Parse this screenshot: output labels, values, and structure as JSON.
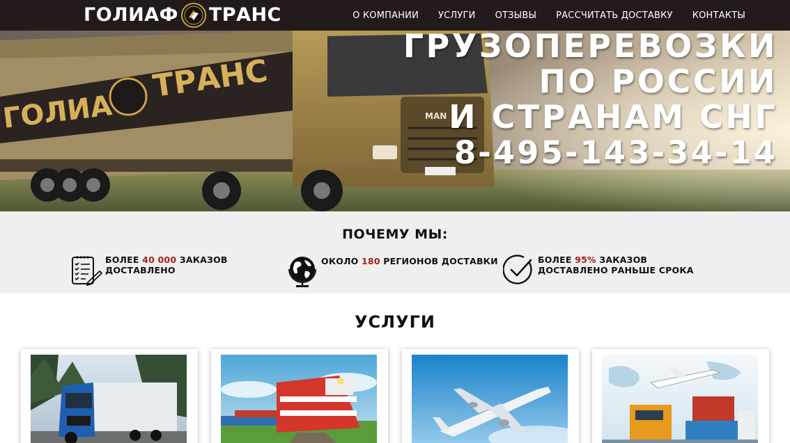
{
  "header": {
    "logo": {
      "left": "ГОЛИАФ",
      "right": "ТРАНС"
    },
    "nav": [
      {
        "label": "О КОМПАНИИ"
      },
      {
        "label": "УСЛУГИ"
      },
      {
        "label": "ОТЗЫВЫ"
      },
      {
        "label": "РАССЧИТАТЬ ДОСТАВКУ"
      },
      {
        "label": "КОНТАКТЫ"
      }
    ]
  },
  "hero": {
    "lines": [
      "ГРУЗОПЕРЕВОЗКИ",
      "ПО РОССИИ",
      "И СТРАНАМ СНГ"
    ],
    "phone": "8-495-143-34-14",
    "truck_banner": {
      "left": "ГОЛИАФ",
      "right": "ТРАНС"
    },
    "truck_badge": "MAN"
  },
  "why": {
    "title": "ПОЧЕМУ МЫ:",
    "features": [
      {
        "icon": "checklist-icon",
        "pre": "БОЛЕЕ ",
        "highlight": "40 000",
        "post": " ЗАКАЗОВ",
        "line2": "ДОСТАВЛЕНО"
      },
      {
        "icon": "globe-icon",
        "pre": "ОКОЛО ",
        "highlight": "180",
        "post": " РЕГИОНОВ ДОСТАВКИ",
        "line2": ""
      },
      {
        "icon": "clock-check-icon",
        "pre": "БОЛЕЕ ",
        "highlight": "95%",
        "post": " ЗАКАЗОВ",
        "line2": "ДОСТАВЛЕНО РАНЬШЕ СРОКА"
      }
    ],
    "highlight_color": "#a3201d"
  },
  "services": {
    "title": "УСЛУГИ",
    "cards": [
      {
        "image": "truck-road-photo"
      },
      {
        "image": "train-photo"
      },
      {
        "image": "airplane-photo"
      },
      {
        "image": "multimodal-photo"
      }
    ]
  },
  "colors": {
    "header_bg": "#231a1c",
    "section_bg": "#efefef"
  }
}
